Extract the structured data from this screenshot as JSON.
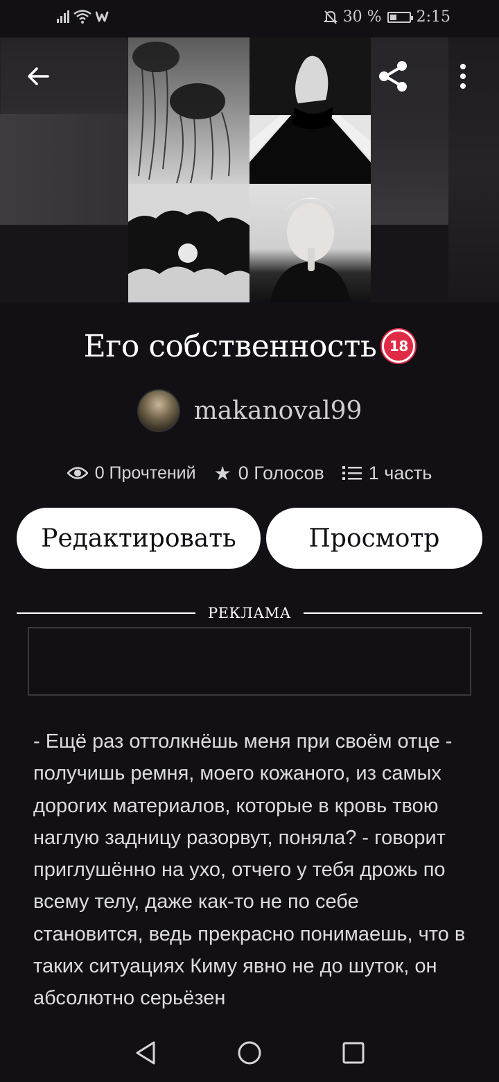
{
  "status_bar": {
    "battery": "30 %",
    "time": "2:15",
    "battery_level": 0.3
  },
  "header": {
    "back_icon": "back-arrow-icon",
    "share_icon": "share-icon",
    "more_icon": "more-vert-icon"
  },
  "story": {
    "title": "Его собственность",
    "rating_badge": "18",
    "author": "makanoval99",
    "stats": {
      "reads": "0 Прочтений",
      "votes": "0 Голосов",
      "parts": "1 часть"
    },
    "edit_label": "Редактировать",
    "view_label": "Просмотр",
    "ad_label": "РЕКЛАМА",
    "excerpt": "- Ещё раз оттолкнёшь меня при своём отце - получишь ремня, моего кожаного, из самых дорогих материалов, которые в кровь твою наглую задницу разорвут, поняла? - говорит приглушённо на ухо, отчего у тебя дрожь по всему телу, даже как-то не по себе становится, ведь прекрасно понимаешь, что в таких ситуациях Киму явно не до шуток, он абсолютно серьёзен"
  },
  "colors": {
    "background": "#121015",
    "badge": "#e02b47",
    "button": "#ffffff"
  }
}
